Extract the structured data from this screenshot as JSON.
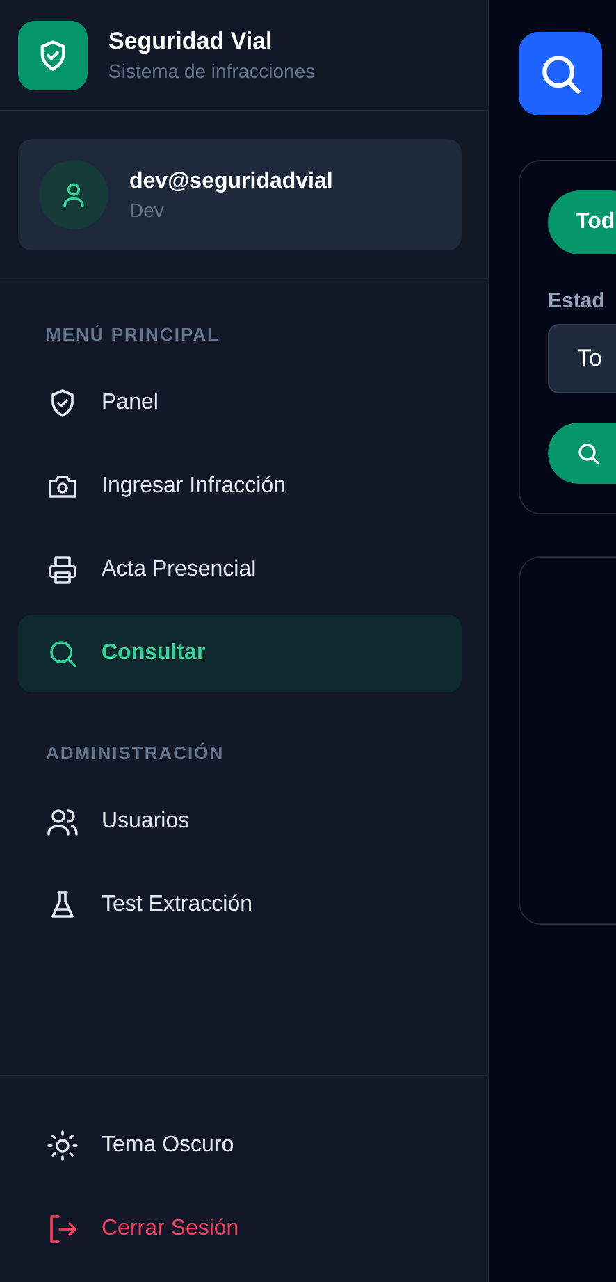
{
  "brand": {
    "title": "Seguridad Vial",
    "subtitle": "Sistema de infracciones"
  },
  "user": {
    "name": "dev@seguridadvial",
    "role": "Dev"
  },
  "sections": [
    {
      "heading": "MENÚ PRINCIPAL",
      "items": [
        {
          "label": "Panel",
          "selected": false
        },
        {
          "label": "Ingresar Infracción",
          "selected": false
        },
        {
          "label": "Acta Presencial",
          "selected": false
        },
        {
          "label": "Consultar",
          "selected": true
        }
      ]
    },
    {
      "heading": "ADMINISTRACIÓN",
      "items": [
        {
          "label": "Usuarios",
          "selected": false
        },
        {
          "label": "Test Extracción",
          "selected": false
        }
      ]
    }
  ],
  "footer": {
    "theme_toggle": "Tema Oscuro",
    "logout": "Cerrar Sesión"
  },
  "main": {
    "filter_pill": "Tod",
    "status_label": "Estad",
    "status_select": "To"
  }
}
